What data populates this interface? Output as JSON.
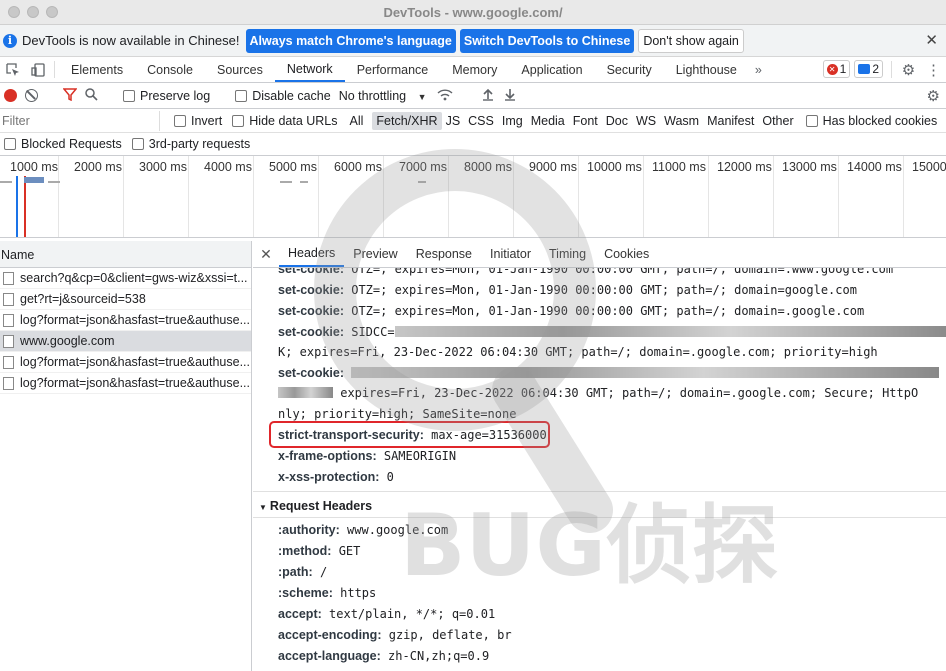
{
  "window": {
    "title": "DevTools - www.google.com/"
  },
  "infobar": {
    "message": "DevTools is now available in Chinese!",
    "btn_match": "Always match Chrome's language",
    "btn_switch": "Switch DevTools to Chinese",
    "btn_dont_show": "Don't show again"
  },
  "main_tabs": [
    "Elements",
    "Console",
    "Sources",
    "Network",
    "Performance",
    "Memory",
    "Application",
    "Security",
    "Lighthouse"
  ],
  "main_tabs_more": "»",
  "counts": {
    "errors": "1",
    "messages": "2"
  },
  "toolbar": {
    "preserve_log": "Preserve log",
    "disable_cache": "Disable cache",
    "throttling": "No throttling"
  },
  "filter": {
    "placeholder": "Filter",
    "invert": "Invert",
    "hide_data_urls": "Hide data URLs",
    "types": [
      "All",
      "Fetch/XHR",
      "JS",
      "CSS",
      "Img",
      "Media",
      "Font",
      "Doc",
      "WS",
      "Wasm",
      "Manifest",
      "Other"
    ],
    "selected_type": "Fetch/XHR",
    "has_blocked_cookies": "Has blocked cookies",
    "blocked_requests": "Blocked Requests",
    "third_party": "3rd-party requests"
  },
  "timeline": {
    "ticks": [
      "1000 ms",
      "2000 ms",
      "3000 ms",
      "4000 ms",
      "5000 ms",
      "6000 ms",
      "7000 ms",
      "8000 ms",
      "9000 ms",
      "10000 ms",
      "11000 ms",
      "12000 ms",
      "13000 ms",
      "14000 ms",
      "15000"
    ]
  },
  "requests": {
    "header": "Name",
    "items": [
      "search?q&cp=0&client=gws-wiz&xssi=t...",
      "get?rt=j&sourceid=538",
      "log?format=json&hasfast=true&authuse...",
      "www.google.com",
      "log?format=json&hasfast=true&authuse...",
      "log?format=json&hasfast=true&authuse..."
    ],
    "selected_index": 3
  },
  "detail_tabs": [
    "Headers",
    "Preview",
    "Response",
    "Initiator",
    "Timing",
    "Cookies"
  ],
  "response_headers": {
    "r0_k": "set-cookie:",
    "r0_v": "OTZ=; expires=Mon, 01-Jan-1990 00:00:00 GMT; path=/; domain=.www.google.com",
    "r1_k": "set-cookie:",
    "r1_v": "OTZ=; expires=Mon, 01-Jan-1990 00:00:00 GMT; path=/; domain=google.com",
    "r2_k": "set-cookie:",
    "r2_v": "OTZ=; expires=Mon, 01-Jan-1990 00:00:00 GMT; path=/; domain=.google.com",
    "r3_k": "set-cookie:",
    "r3_v": "SIDCC=",
    "r4_v": "K; expires=Fri, 23-Dec-2022 06:04:30 GMT; path=/; domain=.google.com; priority=high",
    "r5_k": "set-cookie:",
    "r6_v": "expires=Fri, 23-Dec-2022 06:04:30 GMT; path=/; domain=.google.com; Secure; HttpO",
    "r7_v": "nly; priority=high; SameSite=none",
    "r8_k": "strict-transport-security:",
    "r8_v": "max-age=31536000",
    "r9_k": "x-frame-options:",
    "r9_v": "SAMEORIGIN",
    "r10_k": "x-xss-protection:",
    "r10_v": "0"
  },
  "request_headers": {
    "title": "Request Headers",
    "q0_k": ":authority:",
    "q0_v": "www.google.com",
    "q1_k": ":method:",
    "q1_v": "GET",
    "q2_k": ":path:",
    "q2_v": "/",
    "q3_k": ":scheme:",
    "q3_v": "https",
    "q4_k": "accept:",
    "q4_v": "text/plain, */*; q=0.01",
    "q5_k": "accept-encoding:",
    "q5_v": "gzip, deflate, br",
    "q6_k": "accept-language:",
    "q6_v": "zh-CN,zh;q=0.9"
  },
  "watermark": {
    "text": "BUG侦探"
  },
  "colors": {
    "accent": "#1a73e8",
    "highlight": "#e0262b",
    "record": "#d93025"
  }
}
